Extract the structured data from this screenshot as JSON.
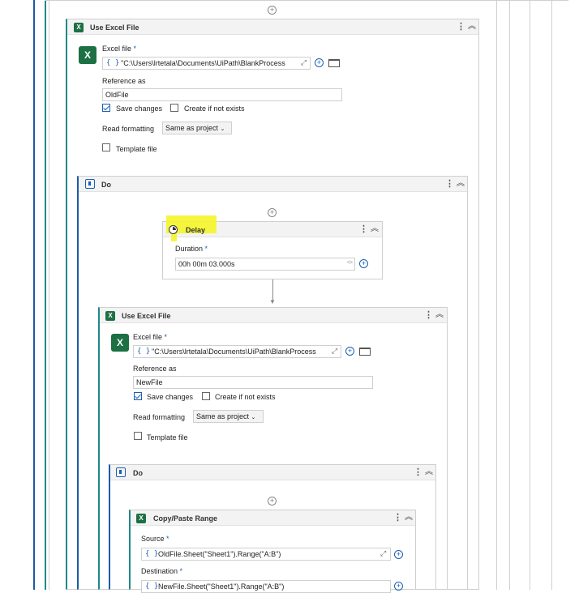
{
  "outer": {
    "title": "Use Excel File",
    "excel_file_label": "Excel file",
    "excel_file_value": "\"C:\\Users\\lrtetala\\Documents\\UiPath\\BlankProcess",
    "reference_label": "Reference as",
    "reference_value": "OldFile",
    "save_changes": "Save changes",
    "create_if_not_exists": "Create if not exists",
    "read_formatting_label": "Read formatting",
    "read_formatting_value": "Same as project",
    "template_file": "Template file"
  },
  "do1": {
    "title": "Do"
  },
  "delay": {
    "title": "Delay",
    "duration_label": "Duration",
    "duration_value": "00h 00m 03.000s"
  },
  "inner": {
    "title": "Use Excel File",
    "excel_file_label": "Excel file",
    "excel_file_value": "\"C:\\Users\\lrtetala\\Documents\\UiPath\\BlankProcess",
    "reference_label": "Reference as",
    "reference_value": "NewFile",
    "save_changes": "Save changes",
    "create_if_not_exists": "Create if not exists",
    "read_formatting_label": "Read formatting",
    "read_formatting_value": "Same as project",
    "template_file": "Template file"
  },
  "do2": {
    "title": "Do"
  },
  "copy": {
    "title": "Copy/Paste Range",
    "source_label": "Source",
    "source_value": "OldFile.Sheet(\"Sheet1\").Range(\"A:B\")",
    "destination_label": "Destination",
    "destination_value": "NewFile.Sheet(\"Sheet1\").Range(\"A:B\")"
  },
  "icons": {
    "kebab": "⋮",
    "collapse": "︽",
    "plus": "+",
    "expand": "⤢",
    "brace": "{ }",
    "excel": "X",
    "arrow_down": "▼"
  },
  "colors": {
    "accent": "#1a5fb4",
    "excel_green": "#1d7044",
    "highlight": "#f5f52a"
  }
}
